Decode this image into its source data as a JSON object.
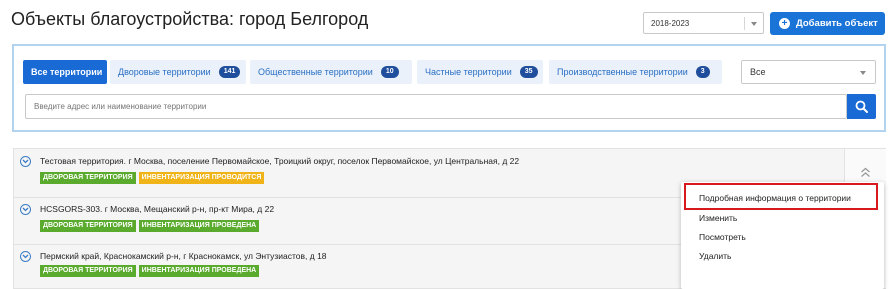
{
  "page": {
    "title": "Объекты благоустройства: город Белгород"
  },
  "header": {
    "year_select_value": "2018-2023",
    "add_button_label": "Добавить объект"
  },
  "filters": {
    "tabs": [
      {
        "label": "Все территории",
        "count": ""
      },
      {
        "label": "Дворовые территории",
        "count": "141"
      },
      {
        "label": "Общественные территории",
        "count": "10"
      },
      {
        "label": "Частные территории",
        "count": "35"
      },
      {
        "label": "Производственные территории",
        "count": "3"
      }
    ],
    "type_select_value": "Все",
    "search_placeholder": "Введите адрес или наименование территории"
  },
  "objects": [
    {
      "text": "Тестовая территория. г Москва, поселение Первомайское, Троицкий округ, поселок Первомайское, ул Центральная, д 22",
      "badges": [
        "ДВОРОВАЯ ТЕРРИТОРИЯ",
        "ИНВЕНТАРИЗАЦИЯ ПРОВОДИТСЯ"
      ]
    },
    {
      "text": "HCSGORS-303. г Москва, Мещанский р-н, пр-кт Мира, д 22",
      "badges": [
        "ДВОРОВАЯ ТЕРРИТОРИЯ",
        "ИНВЕНТАРИЗАЦИЯ ПРОВЕДЕНА"
      ]
    },
    {
      "text": "Пермский край, Краснокамский р-н, г Краснокамск, ул Энтузиастов, д 18",
      "badges": [
        "ДВОРОВАЯ ТЕРРИТОРИЯ",
        "ИНВЕНТАРИЗАЦИЯ ПРОВЕДЕНА"
      ]
    }
  ],
  "context_menu": {
    "items": [
      "Подробная информация о территории",
      "Изменить",
      "Посмотреть",
      "Удалить"
    ]
  },
  "colors": {
    "accent": "#1a6ad6",
    "badge_green": "#59aa2d",
    "badge_orange": "#f0b318",
    "highlight": "#d6191e"
  }
}
